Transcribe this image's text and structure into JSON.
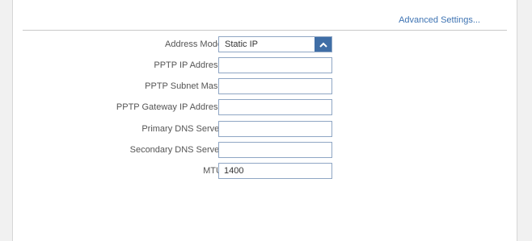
{
  "header": {
    "advanced_link": "Advanced Settings..."
  },
  "form": {
    "address_mode": {
      "label": "Address Mode:",
      "value": "Static IP",
      "arrow_icon": "chevron-up-icon"
    },
    "pptp_ip_address": {
      "label": "PPTP IP Address:",
      "value": "",
      "placeholder": ""
    },
    "pptp_subnet_mask": {
      "label": "PPTP Subnet Mask:",
      "value": "",
      "placeholder": ""
    },
    "pptp_gateway_ip": {
      "label": "PPTP Gateway IP Address:",
      "value": "",
      "placeholder": ""
    },
    "primary_dns": {
      "label": "Primary DNS Server:",
      "value": "",
      "placeholder": ""
    },
    "secondary_dns": {
      "label": "Secondary DNS Server:",
      "value": "",
      "placeholder": ""
    },
    "mtu": {
      "label": "MTU:",
      "value": "1400",
      "placeholder": ""
    }
  },
  "colors": {
    "accent": "#3f6ea6",
    "link": "#3f74b3",
    "field_border": "#8fa6c4"
  }
}
